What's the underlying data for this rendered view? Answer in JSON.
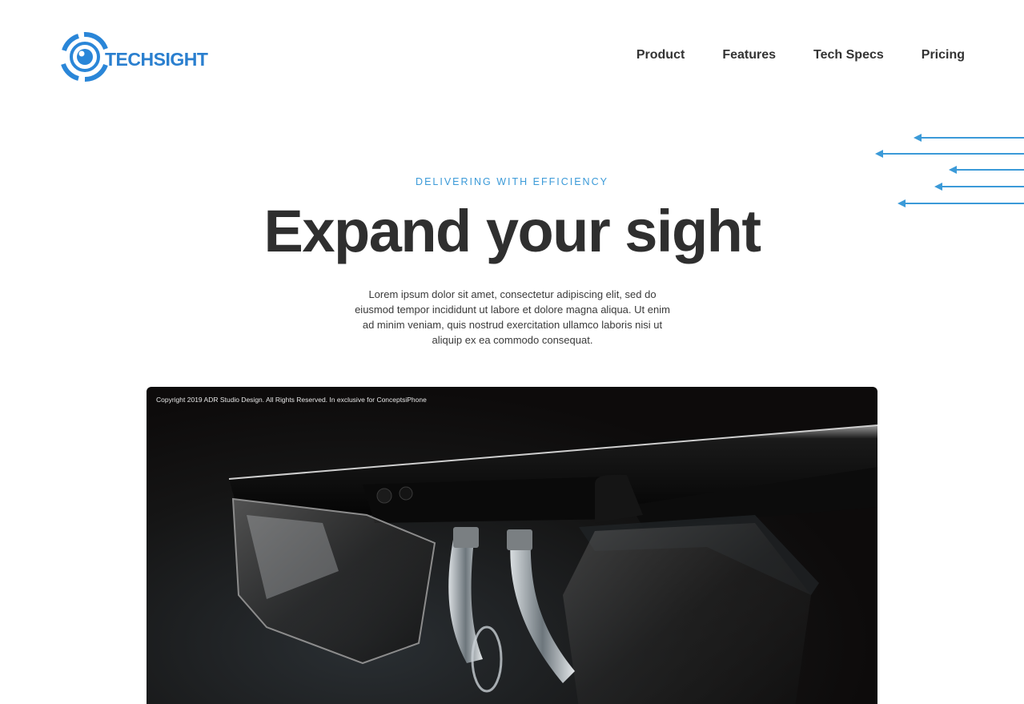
{
  "brand": {
    "name": "TECHSIGHT",
    "logo_icon": "eye-lens-icon",
    "color": "#2a7fcf"
  },
  "nav": {
    "items": [
      {
        "label": "Product"
      },
      {
        "label": "Features"
      },
      {
        "label": "Tech Specs"
      },
      {
        "label": "Pricing"
      }
    ]
  },
  "decoration": {
    "icon": "left-arrow-lines-icon",
    "color": "#3b9ad8",
    "count": 5
  },
  "hero": {
    "eyebrow": "DELIVERING WITH EFFICIENCY",
    "headline": "Expand your sight",
    "body": "Lorem ipsum dolor sit amet, consectetur adipiscing elit, sed do eiusmod tempor incididunt ut labore et dolore magna aliqua. Ut enim ad minim veniam, quis nostrud exercitation ullamco laboris nisi ut aliquip ex ea commodo consequat.",
    "accent_color": "#3b9ad8"
  },
  "product_image": {
    "caption": "Copyright 2019 ADR Studio Design. All Rights Reserved. In exclusive for ConceptsiPhone",
    "subject_icon": "smart-glasses-icon"
  }
}
